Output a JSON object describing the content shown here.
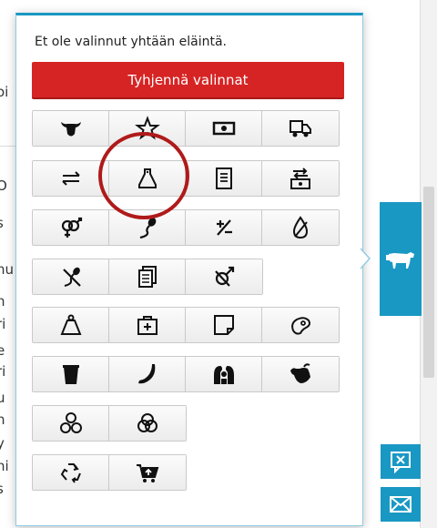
{
  "popover": {
    "info_text": "Et ole valinnut yhtään eläintä.",
    "clear_button": "Tyhjennä valinnat"
  },
  "background_fragments": [
    "oi",
    "O",
    "s",
    "nu",
    "n",
    "ri",
    "e",
    "ri",
    "u",
    "n",
    "y",
    "ni",
    "s"
  ],
  "icon_rows": [
    [
      "cow-head-icon",
      "star-icon",
      "money-icon",
      "truck-icon"
    ],
    [
      "transfer-arrows-icon",
      "ear-tag-icon",
      "document-icon",
      "money-exchange-icon"
    ],
    [
      "gender-icon",
      "sperm-icon",
      "plus-minus-icon",
      "drop-slash-icon"
    ],
    [
      "sperm-slash-icon",
      "documents-icon",
      "male-slash-icon"
    ],
    [
      "weight-icon",
      "first-aid-icon",
      "note-icon",
      "meat-icon"
    ],
    [
      "bucket-icon",
      "horn-icon",
      "family-icon",
      "bull-head-icon"
    ],
    [
      "three-circles-icon",
      "overlap-circles-icon"
    ],
    [
      "recycle-icon",
      "cart-icon"
    ]
  ],
  "colors": {
    "accent": "#1a98c4",
    "danger": "#d62424",
    "highlight_ring": "#b01a1a"
  }
}
